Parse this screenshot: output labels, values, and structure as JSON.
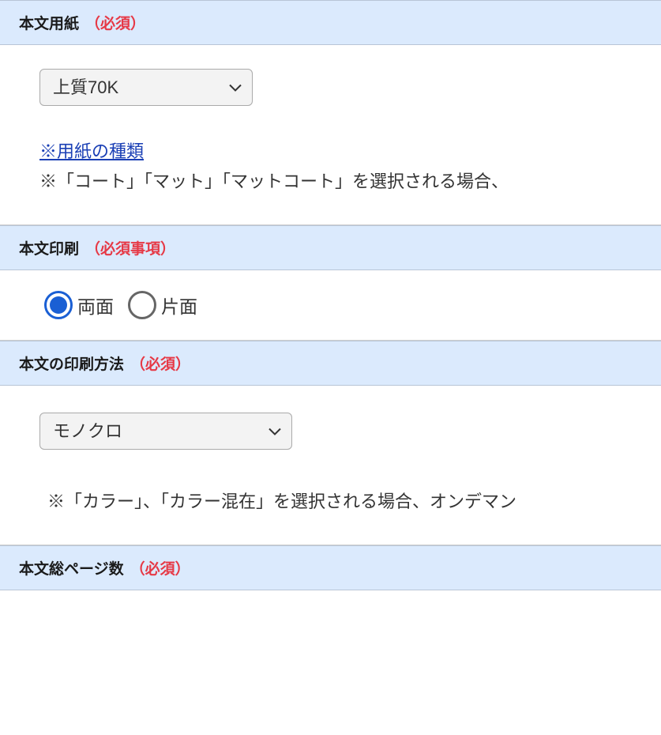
{
  "sections": {
    "paper": {
      "title": "本文用紙",
      "required": "（必須）",
      "select_value": "上質70K",
      "link_text": "※用紙の種類",
      "note": "※「コート」「マット」「マットコート」を選択される場合、"
    },
    "print_side": {
      "title": "本文印刷",
      "required": "（必須事項）",
      "options": {
        "double": "両面",
        "single": "片面"
      }
    },
    "print_method": {
      "title": "本文の印刷方法",
      "required": "（必須）",
      "select_value": "モノクロ",
      "note": "※「カラー」、「カラー混在」を選択される場合、オンデマン"
    },
    "page_count": {
      "title": "本文総ページ数",
      "required": "（必須）"
    }
  }
}
